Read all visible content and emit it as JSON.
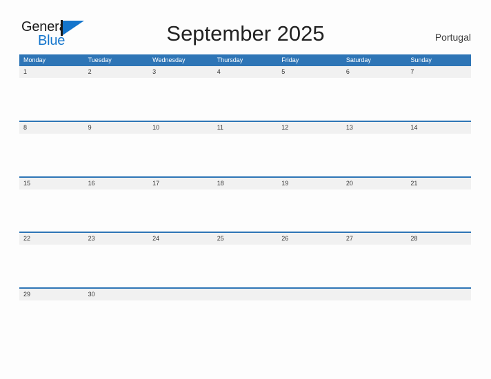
{
  "brand": {
    "name_part1": "General",
    "name_part2": "Blue",
    "flag_icon": "flag-triangle-icon",
    "accent_color": "#1475cc"
  },
  "header": {
    "title": "September 2025",
    "country": "Portugal"
  },
  "colors": {
    "header_blue": "#2e75b6",
    "date_band_gray": "#f1f1f1",
    "page_background": "#fdfdfd",
    "text_dark": "#333333"
  },
  "calendar": {
    "month": "September",
    "year": "2025",
    "weekdays": [
      "Monday",
      "Tuesday",
      "Wednesday",
      "Thursday",
      "Friday",
      "Saturday",
      "Sunday"
    ],
    "weeks": [
      [
        "1",
        "2",
        "3",
        "4",
        "5",
        "6",
        "7"
      ],
      [
        "8",
        "9",
        "10",
        "11",
        "12",
        "13",
        "14"
      ],
      [
        "15",
        "16",
        "17",
        "18",
        "19",
        "20",
        "21"
      ],
      [
        "22",
        "23",
        "24",
        "25",
        "26",
        "27",
        "28"
      ],
      [
        "29",
        "30",
        "",
        "",
        "",
        "",
        ""
      ]
    ]
  }
}
